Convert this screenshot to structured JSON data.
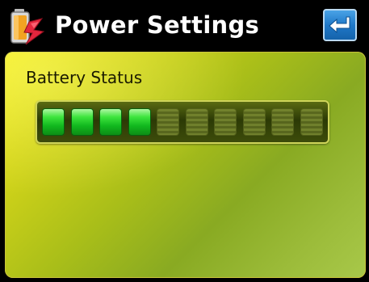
{
  "header": {
    "title": "Power Settings",
    "app_icon": "battery-power-icon",
    "back_icon": "return-arrow-icon"
  },
  "battery": {
    "label": "Battery Status",
    "level_segments": 4,
    "total_segments": 10
  },
  "colors": {
    "title_bar": "#000000",
    "panel_light": "#f4ec1e",
    "panel_dark": "#89aa22",
    "segment_on": "#20c82a",
    "back_button": "#1f78c8"
  }
}
